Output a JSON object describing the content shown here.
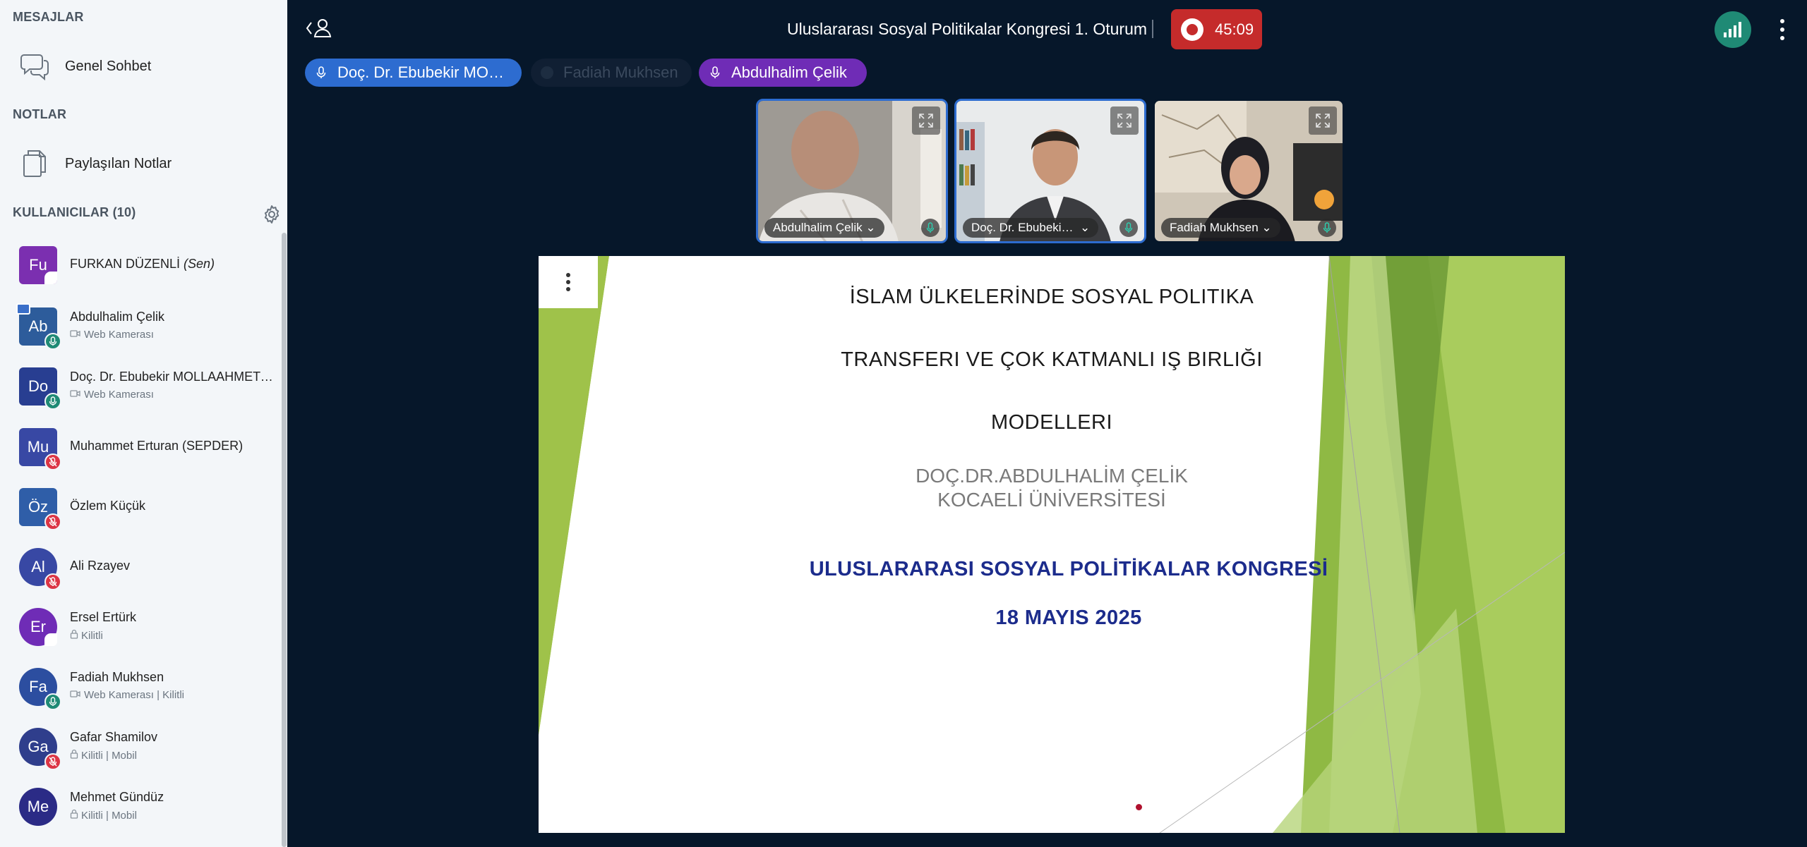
{
  "sidebar": {
    "messages_title": "MESAJLAR",
    "public_chat": "Genel Sohbet",
    "notes_title": "NOTLAR",
    "shared_notes": "Paylaşılan Notlar",
    "users_title": "KULLANICILAR (10)",
    "users": [
      {
        "initials": "Fu",
        "name": "FURKAN DÜZENLİ",
        "self_tag": "(Sen)",
        "color": "#7b2fb0"
      },
      {
        "initials": "Ab",
        "name": "Abdulhalim Çelik",
        "status": "Web Kamerası",
        "color": "#2d5c9b"
      },
      {
        "initials": "Do",
        "name": "Doç. Dr. Ebubekir MOLLAAHMETOĞLU",
        "status": "Web Kamerası",
        "color": "#283e91"
      },
      {
        "initials": "Mu",
        "name": "Muhammet Erturan (SEPDER)",
        "color": "#3848a4"
      },
      {
        "initials": "Öz",
        "name": "Özlem Küçük",
        "color": "#2f5ea8"
      },
      {
        "initials": "Al",
        "name": "Ali Rzayev",
        "color": "#3848a4"
      },
      {
        "initials": "Er",
        "name": "Ersel Ertürk",
        "status": "Kilitli",
        "color": "#6f2cb6"
      },
      {
        "initials": "Fa",
        "name": "Fadiah Mukhsen",
        "status": "Web Kamerası | Kilitli",
        "color": "#2c4ea0"
      },
      {
        "initials": "Ga",
        "name": "Gafar Shamilov",
        "status": "Kilitli | Mobil",
        "color": "#2f3e8c"
      },
      {
        "initials": "Me",
        "name": "Mehmet Gündüz",
        "status": "Kilitli | Mobil",
        "color": "#2b2b86"
      }
    ]
  },
  "header": {
    "title": "Uluslararası Sosyal Politikalar Kongresi 1. Oturum",
    "record_time": "45:09"
  },
  "talkers": [
    {
      "name": "Doç. Dr. Ebubekir MO…"
    },
    {
      "name": "Fadiah Mukhsen"
    },
    {
      "name": "Abdulhalim Çelik"
    }
  ],
  "videos": [
    {
      "name": "Abdulhalim Çelik"
    },
    {
      "name": "Doç. Dr. Ebubeki…"
    },
    {
      "name": "Fadiah Mukhsen"
    }
  ],
  "slide": {
    "line1": "İSLAM ÜLKELERİNDE SOSYAL POLITIKA",
    "line2": "TRANSFERI VE ÇOK KATMANLI IŞ BIRLIĞI",
    "line3": "MODELLERI",
    "author": "DOÇ.DR.ABDULHALİM ÇELİK",
    "university": "KOCAELİ ÜNİVERSİTESİ",
    "congress": "ULUSLARARASI SOSYAL POLİTİKALAR KONGRESİ",
    "date": "18 MAYIS 2025"
  },
  "colors": {
    "accent_blue": "#2d6cd0",
    "accent_purple": "#6f2cb6",
    "record_red": "#c52b2b",
    "connection_green": "#1f8a75",
    "background": "#06172a"
  },
  "icons": [
    "chat-icon",
    "notes-icon",
    "gear-icon",
    "back-icon",
    "user-icon",
    "record-icon",
    "signal-icon",
    "more-vertical-icon",
    "mic-icon",
    "mic-off-icon",
    "webcam-icon",
    "lock-icon",
    "expand-icon",
    "chevron-down-icon"
  ]
}
